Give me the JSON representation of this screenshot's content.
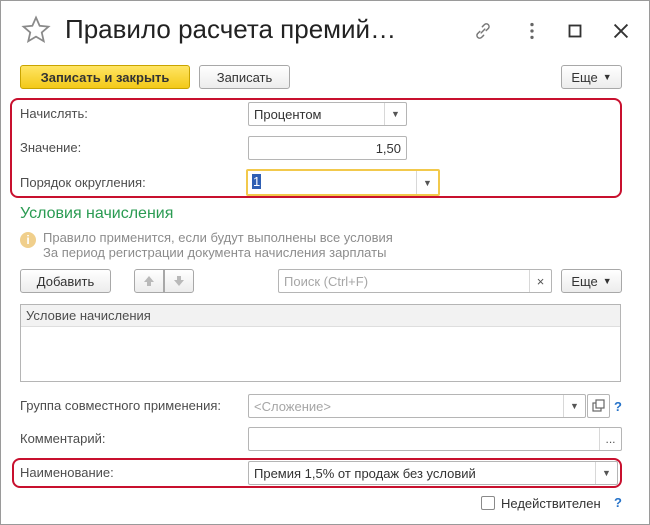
{
  "window": {
    "title": "Правило расчета премий…"
  },
  "toolbar": {
    "save_close_label": "Записать и закрыть",
    "save_label": "Записать",
    "more_label": "Еще"
  },
  "form": {
    "accrue_label": "Начислять:",
    "accrue_value": "Процентом",
    "value_label": "Значение:",
    "value_value": "1,50",
    "rounding_label": "Порядок округления:",
    "rounding_value": "1"
  },
  "conditions": {
    "title": "Условия начисления",
    "hint_line1": "Правило применится, если будут выполнены все условия",
    "hint_line2": "За период регистрации документа начисления зарплаты",
    "add_label": "Добавить",
    "search_placeholder": "Поиск (Ctrl+F)",
    "more_label": "Еще",
    "table_header": "Условие начисления"
  },
  "footer": {
    "group_label": "Группа совместного применения:",
    "group_placeholder": "<Сложение>",
    "comment_label": "Комментарий:",
    "comment_value": "",
    "name_label": "Наименование:",
    "name_value": "Премия 1,5% от продаж без условий",
    "inactive_label": "Недействителен",
    "help_mark": "?"
  },
  "icons": [
    "star-icon",
    "link-icon",
    "more-vertical-icon",
    "maximize-icon",
    "close-icon",
    "arrow-up-icon",
    "arrow-down-icon",
    "clear-icon",
    "ellipsis-icon",
    "open-icon",
    "info-icon"
  ],
  "colors": {
    "primary_button": "#f3c918",
    "highlight_border": "#c8102e",
    "section_title": "#2a9b52",
    "help": "#2673c9",
    "focus_field": "#f2c94c"
  }
}
